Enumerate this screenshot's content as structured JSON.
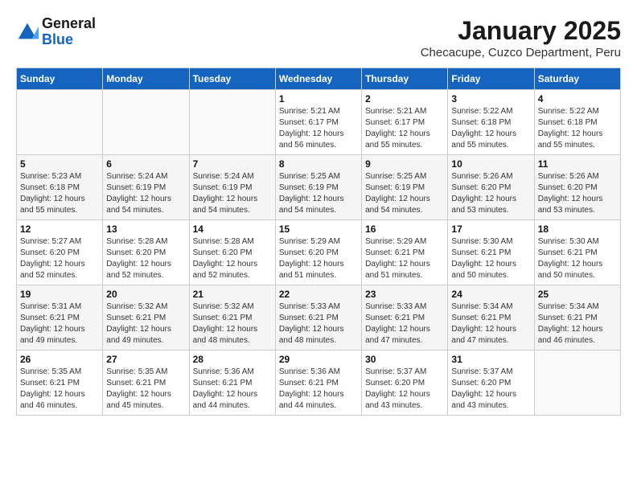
{
  "header": {
    "logo_line1": "General",
    "logo_line2": "Blue",
    "title": "January 2025",
    "subtitle": "Checacupe, Cuzco Department, Peru"
  },
  "weekdays": [
    "Sunday",
    "Monday",
    "Tuesday",
    "Wednesday",
    "Thursday",
    "Friday",
    "Saturday"
  ],
  "weeks": [
    [
      {
        "day": "",
        "sunrise": "",
        "sunset": "",
        "daylight": ""
      },
      {
        "day": "",
        "sunrise": "",
        "sunset": "",
        "daylight": ""
      },
      {
        "day": "",
        "sunrise": "",
        "sunset": "",
        "daylight": ""
      },
      {
        "day": "1",
        "sunrise": "Sunrise: 5:21 AM",
        "sunset": "Sunset: 6:17 PM",
        "daylight": "Daylight: 12 hours and 56 minutes."
      },
      {
        "day": "2",
        "sunrise": "Sunrise: 5:21 AM",
        "sunset": "Sunset: 6:17 PM",
        "daylight": "Daylight: 12 hours and 55 minutes."
      },
      {
        "day": "3",
        "sunrise": "Sunrise: 5:22 AM",
        "sunset": "Sunset: 6:18 PM",
        "daylight": "Daylight: 12 hours and 55 minutes."
      },
      {
        "day": "4",
        "sunrise": "Sunrise: 5:22 AM",
        "sunset": "Sunset: 6:18 PM",
        "daylight": "Daylight: 12 hours and 55 minutes."
      }
    ],
    [
      {
        "day": "5",
        "sunrise": "Sunrise: 5:23 AM",
        "sunset": "Sunset: 6:18 PM",
        "daylight": "Daylight: 12 hours and 55 minutes."
      },
      {
        "day": "6",
        "sunrise": "Sunrise: 5:24 AM",
        "sunset": "Sunset: 6:19 PM",
        "daylight": "Daylight: 12 hours and 54 minutes."
      },
      {
        "day": "7",
        "sunrise": "Sunrise: 5:24 AM",
        "sunset": "Sunset: 6:19 PM",
        "daylight": "Daylight: 12 hours and 54 minutes."
      },
      {
        "day": "8",
        "sunrise": "Sunrise: 5:25 AM",
        "sunset": "Sunset: 6:19 PM",
        "daylight": "Daylight: 12 hours and 54 minutes."
      },
      {
        "day": "9",
        "sunrise": "Sunrise: 5:25 AM",
        "sunset": "Sunset: 6:19 PM",
        "daylight": "Daylight: 12 hours and 54 minutes."
      },
      {
        "day": "10",
        "sunrise": "Sunrise: 5:26 AM",
        "sunset": "Sunset: 6:20 PM",
        "daylight": "Daylight: 12 hours and 53 minutes."
      },
      {
        "day": "11",
        "sunrise": "Sunrise: 5:26 AM",
        "sunset": "Sunset: 6:20 PM",
        "daylight": "Daylight: 12 hours and 53 minutes."
      }
    ],
    [
      {
        "day": "12",
        "sunrise": "Sunrise: 5:27 AM",
        "sunset": "Sunset: 6:20 PM",
        "daylight": "Daylight: 12 hours and 52 minutes."
      },
      {
        "day": "13",
        "sunrise": "Sunrise: 5:28 AM",
        "sunset": "Sunset: 6:20 PM",
        "daylight": "Daylight: 12 hours and 52 minutes."
      },
      {
        "day": "14",
        "sunrise": "Sunrise: 5:28 AM",
        "sunset": "Sunset: 6:20 PM",
        "daylight": "Daylight: 12 hours and 52 minutes."
      },
      {
        "day": "15",
        "sunrise": "Sunrise: 5:29 AM",
        "sunset": "Sunset: 6:20 PM",
        "daylight": "Daylight: 12 hours and 51 minutes."
      },
      {
        "day": "16",
        "sunrise": "Sunrise: 5:29 AM",
        "sunset": "Sunset: 6:21 PM",
        "daylight": "Daylight: 12 hours and 51 minutes."
      },
      {
        "day": "17",
        "sunrise": "Sunrise: 5:30 AM",
        "sunset": "Sunset: 6:21 PM",
        "daylight": "Daylight: 12 hours and 50 minutes."
      },
      {
        "day": "18",
        "sunrise": "Sunrise: 5:30 AM",
        "sunset": "Sunset: 6:21 PM",
        "daylight": "Daylight: 12 hours and 50 minutes."
      }
    ],
    [
      {
        "day": "19",
        "sunrise": "Sunrise: 5:31 AM",
        "sunset": "Sunset: 6:21 PM",
        "daylight": "Daylight: 12 hours and 49 minutes."
      },
      {
        "day": "20",
        "sunrise": "Sunrise: 5:32 AM",
        "sunset": "Sunset: 6:21 PM",
        "daylight": "Daylight: 12 hours and 49 minutes."
      },
      {
        "day": "21",
        "sunrise": "Sunrise: 5:32 AM",
        "sunset": "Sunset: 6:21 PM",
        "daylight": "Daylight: 12 hours and 48 minutes."
      },
      {
        "day": "22",
        "sunrise": "Sunrise: 5:33 AM",
        "sunset": "Sunset: 6:21 PM",
        "daylight": "Daylight: 12 hours and 48 minutes."
      },
      {
        "day": "23",
        "sunrise": "Sunrise: 5:33 AM",
        "sunset": "Sunset: 6:21 PM",
        "daylight": "Daylight: 12 hours and 47 minutes."
      },
      {
        "day": "24",
        "sunrise": "Sunrise: 5:34 AM",
        "sunset": "Sunset: 6:21 PM",
        "daylight": "Daylight: 12 hours and 47 minutes."
      },
      {
        "day": "25",
        "sunrise": "Sunrise: 5:34 AM",
        "sunset": "Sunset: 6:21 PM",
        "daylight": "Daylight: 12 hours and 46 minutes."
      }
    ],
    [
      {
        "day": "26",
        "sunrise": "Sunrise: 5:35 AM",
        "sunset": "Sunset: 6:21 PM",
        "daylight": "Daylight: 12 hours and 46 minutes."
      },
      {
        "day": "27",
        "sunrise": "Sunrise: 5:35 AM",
        "sunset": "Sunset: 6:21 PM",
        "daylight": "Daylight: 12 hours and 45 minutes."
      },
      {
        "day": "28",
        "sunrise": "Sunrise: 5:36 AM",
        "sunset": "Sunset: 6:21 PM",
        "daylight": "Daylight: 12 hours and 44 minutes."
      },
      {
        "day": "29",
        "sunrise": "Sunrise: 5:36 AM",
        "sunset": "Sunset: 6:21 PM",
        "daylight": "Daylight: 12 hours and 44 minutes."
      },
      {
        "day": "30",
        "sunrise": "Sunrise: 5:37 AM",
        "sunset": "Sunset: 6:20 PM",
        "daylight": "Daylight: 12 hours and 43 minutes."
      },
      {
        "day": "31",
        "sunrise": "Sunrise: 5:37 AM",
        "sunset": "Sunset: 6:20 PM",
        "daylight": "Daylight: 12 hours and 43 minutes."
      },
      {
        "day": "",
        "sunrise": "",
        "sunset": "",
        "daylight": ""
      }
    ]
  ]
}
